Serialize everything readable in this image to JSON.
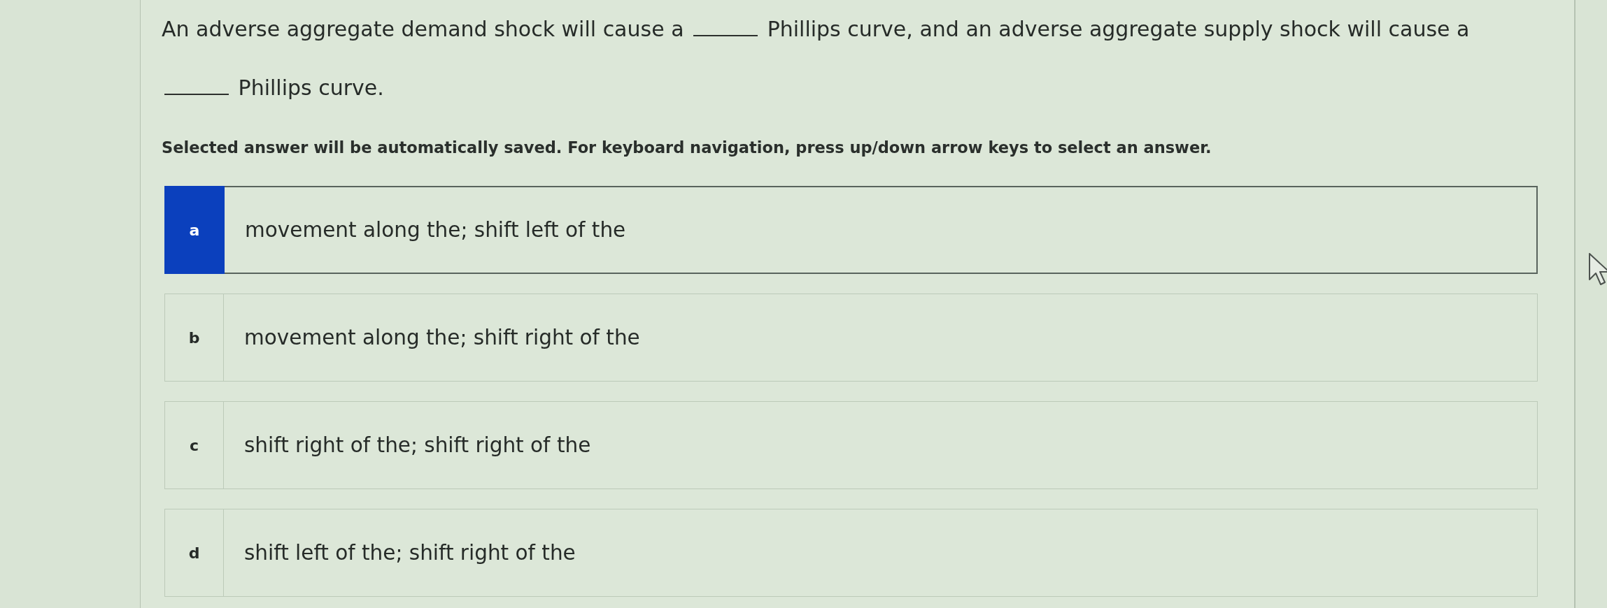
{
  "question": [
    {
      "kind": "text",
      "text": "An adverse aggregate demand shock will cause a"
    },
    {
      "kind": "blank"
    },
    {
      "kind": "text",
      "text": "Phillips curve, and an adverse aggregate supply shock will cause a"
    },
    {
      "kind": "blank"
    },
    {
      "kind": "text",
      "text": "Phillips curve."
    }
  ],
  "instruction": "Selected answer will be automatically saved. For keyboard navigation, press up/down arrow keys to select an answer.",
  "options": [
    {
      "letter": "a",
      "text": "movement along the; shift left of the",
      "selected": true
    },
    {
      "letter": "b",
      "text": "movement along the; shift right of the",
      "selected": false
    },
    {
      "letter": "c",
      "text": "shift right of the; shift right of the",
      "selected": false
    },
    {
      "letter": "d",
      "text": "shift left of the; shift right of the",
      "selected": false
    }
  ]
}
